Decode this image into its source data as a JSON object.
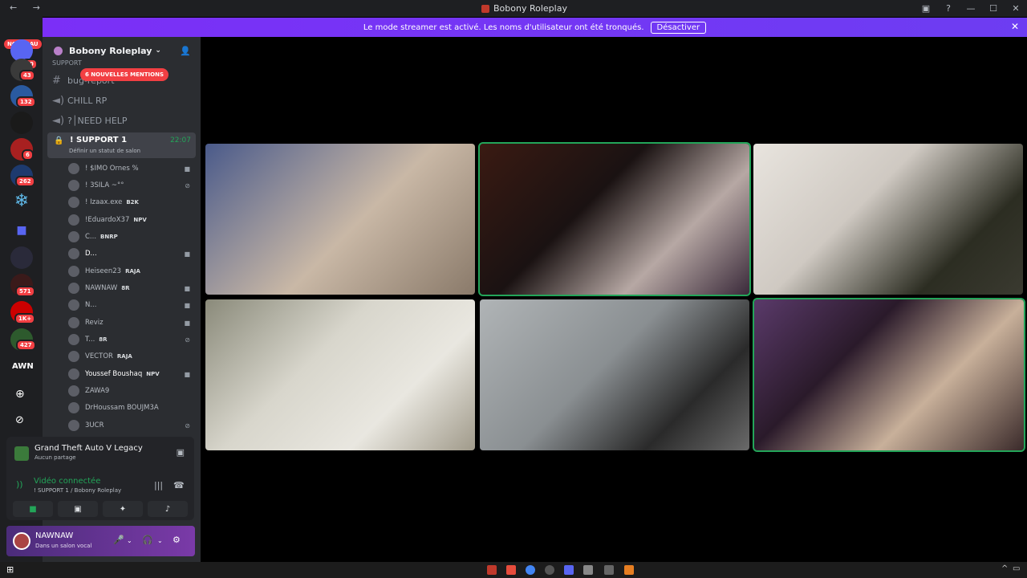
{
  "window": {
    "title": "Bobony Roleplay",
    "nav": "←  →"
  },
  "banner": {
    "text": "Le mode streamer est activé. Les noms d'utilisateur ont été tronqués.",
    "button": "Désactiver"
  },
  "servers": {
    "new_badge": "NOUVEAU",
    "badges": [
      "20",
      "43",
      "132",
      "6",
      "262",
      "571",
      "1K+",
      "427"
    ],
    "awn": "AWN"
  },
  "server": {
    "name": "Bobony Roleplay"
  },
  "channels": {
    "mentions_badge": "6 NOUVELLES MENTIONS",
    "items": [
      {
        "name": "SUPPORT"
      },
      {
        "name": "bug-report"
      },
      {
        "name": "CHILL RP"
      },
      {
        "name": "?│NEED HELP"
      }
    ],
    "active": {
      "name": "! SUPPORT 1",
      "time": "22:07",
      "status": "Définir un statut de salon"
    }
  },
  "members": [
    {
      "name": "! $IMO Ornes %",
      "tag": ""
    },
    {
      "name": "! 3SILA ~°°",
      "tag": ""
    },
    {
      "name": "! Izaax.exe",
      "tag": "B2K"
    },
    {
      "name": "!EduardoX37",
      "tag": "NPV"
    },
    {
      "name": "C...",
      "tag": "BNRP"
    },
    {
      "name": "D...",
      "tag": ""
    },
    {
      "name": "Heiseen23",
      "tag": "RAJA"
    },
    {
      "name": "NAWNAW",
      "tag": "8R"
    },
    {
      "name": "N...",
      "tag": ""
    },
    {
      "name": "Reviz",
      "tag": ""
    },
    {
      "name": "T...",
      "tag": "8R"
    },
    {
      "name": "VECTOR",
      "tag": "RAJA"
    },
    {
      "name": "Youssef Boushaq",
      "tag": "NPV"
    },
    {
      "name": "ZAWA9",
      "tag": ""
    },
    {
      "name": "DrHoussam BOUJM3A",
      "tag": ""
    },
    {
      "name": "3UCR",
      "tag": ""
    }
  ],
  "activity": {
    "game": "Grand Theft Auto V Legacy",
    "sub": "Aucun partage"
  },
  "voice": {
    "status": "Vidéo connectée",
    "channel": "! SUPPORT 1 / Bobony Roleplay"
  },
  "user": {
    "name": "NAWNAW",
    "status": "Dans un salon vocal"
  },
  "colors": {
    "accent": "#5865f2",
    "online": "#23a559",
    "danger": "#f23f43",
    "banner": "#7b2ff7"
  }
}
